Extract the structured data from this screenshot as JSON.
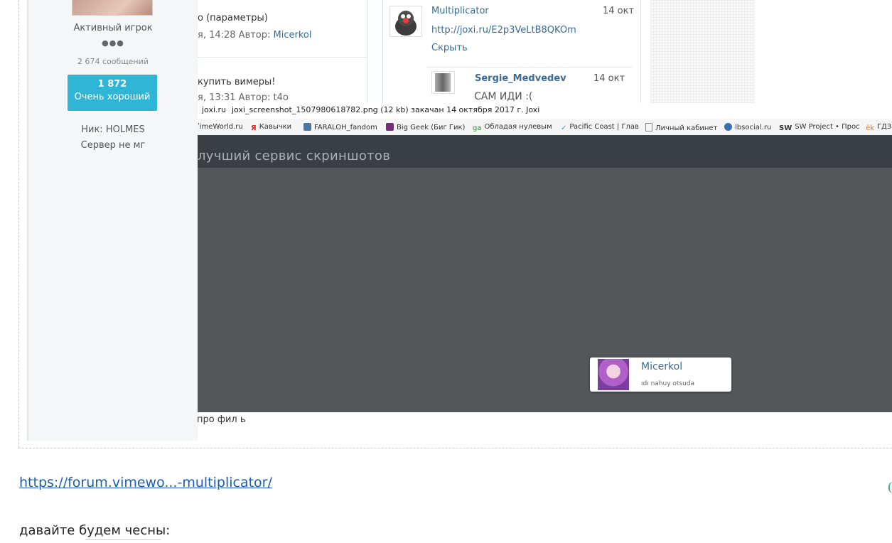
{
  "profile": {
    "rank": "Активный игрок",
    "rank_dots": "●●●",
    "posts": "2 674 сообщений",
    "reputation_value": "1 872",
    "reputation_label": "Очень хороший",
    "nick": "Ник: HOLMES",
    "server": "Сервер не мг"
  },
  "topics": [
    {
      "title": "о (параметры)",
      "meta_prefix": "я, 14:28 Автор: ",
      "author": "Micerkol"
    },
    {
      "title": "купить вимеры!",
      "meta_prefix": "я, 13:31 Автор: ",
      "author": "t4o"
    }
  ],
  "comments": {
    "main": {
      "author": "Multiplicator",
      "date": "14 окт",
      "link": "http://joxi.ru/E2p3VeLtB8QKOm",
      "hide_label": "Скрыть"
    },
    "reply": {
      "author": "Sergie_Medvedev",
      "date": "14 окт",
      "text": "САМ ИДИ :("
    }
  },
  "file_info": {
    "site": "joxi.ru",
    "text": "joxi_screenshot_1507980618782.png (12 kb) закачан 14 октября 2017 г. Joxi"
  },
  "bookmarks": [
    {
      "label": "ʹimeWorld.ru",
      "icon": "none"
    },
    {
      "label": "Кавычки",
      "icon": "yandex-icon",
      "color": "#e52620"
    },
    {
      "label": "FARALOH_fandom",
      "icon": "vk-icon",
      "color": "#4a76a8"
    },
    {
      "label": "Big Geek (Биг Гик)",
      "icon": "bookmark-icon",
      "color": "#7a2a7a"
    },
    {
      "label": "Обладая нулевым",
      "icon": "goodreads-icon",
      "color": "#3a8a3a"
    },
    {
      "label": "Pacific Coast | Глав",
      "icon": "check-icon",
      "color": "#5a8fc8"
    },
    {
      "label": "Личный кабинет",
      "icon": "page-icon",
      "color": "#888888"
    },
    {
      "label": "lbsocial.ru",
      "icon": "globe-icon",
      "color": "#3a70b0"
    },
    {
      "label": "SW Project • Прос",
      "icon": "sw-icon",
      "color": "#222222"
    },
    {
      "label": "ГДЗ",
      "icon": "gdz-icon",
      "color": "#e07b2a"
    }
  ],
  "joxi": {
    "tagline": "лучший сервис скриншотов",
    "popup_name": "Micerkol",
    "popup_msg": "ıdı nahuy otsuda"
  },
  "under_text": "про фил ь",
  "post": {
    "link": "https://forum.vimewo...-multiplicator/",
    "text": "давайте будем чесны:"
  }
}
